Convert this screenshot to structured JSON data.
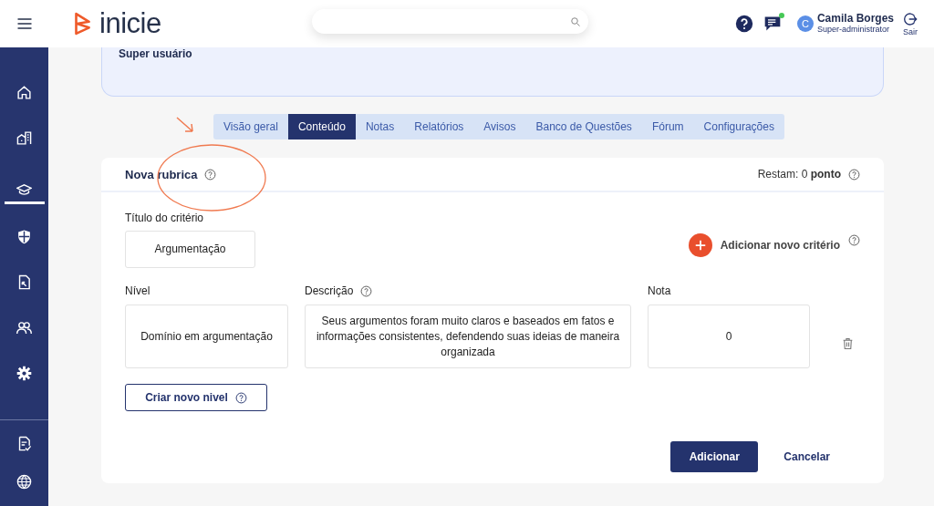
{
  "header": {
    "brand": "inicie",
    "chat_unread": true,
    "user": {
      "initial": "C",
      "name": "Camila Borges",
      "role": "Super-administrator"
    },
    "logout": "Sair"
  },
  "sidebar": {
    "items": [
      {
        "kind": "home",
        "selected": false
      },
      {
        "kind": "building",
        "selected": false
      },
      {
        "kind": "cap",
        "selected": true
      },
      {
        "kind": "shield",
        "selected": false
      },
      {
        "kind": "file",
        "selected": false
      },
      {
        "kind": "people",
        "selected": false
      },
      {
        "kind": "gear",
        "selected": false
      }
    ],
    "footer_items": [
      {
        "kind": "report",
        "selected": false
      },
      {
        "kind": "globe",
        "selected": false
      }
    ]
  },
  "banner": {
    "text": "Super usuário"
  },
  "tabs": [
    {
      "label": "Visão geral",
      "selected": false
    },
    {
      "label": "Conteúdo",
      "selected": true
    },
    {
      "label": "Notas",
      "selected": false
    },
    {
      "label": "Relatórios",
      "selected": false
    },
    {
      "label": "Avisos",
      "selected": false
    },
    {
      "label": "Banco de Questões",
      "selected": false
    },
    {
      "label": "Fórum",
      "selected": false
    },
    {
      "label": "Configurações",
      "selected": false
    }
  ],
  "rubric": {
    "title": "Nova rubrica",
    "remaining": "Restam: 0 **ponto**",
    "criterion": {
      "label": "Título do critério",
      "value": "Argumentação"
    },
    "add_criterion": "Adicionar novo critério",
    "columns": [
      "Nível",
      "Descrição",
      "Nota"
    ],
    "levels": [
      {
        "level": "Domínio em argumentação",
        "description": "Seus argumentos foram muito claros e baseados em fatos e informações consistentes, defendendo suas ideias de maneira organizada",
        "grade": "0"
      }
    ],
    "create_level": "Criar novo nivel",
    "submit": "Adicionar",
    "cancel": "Cancelar"
  }
}
